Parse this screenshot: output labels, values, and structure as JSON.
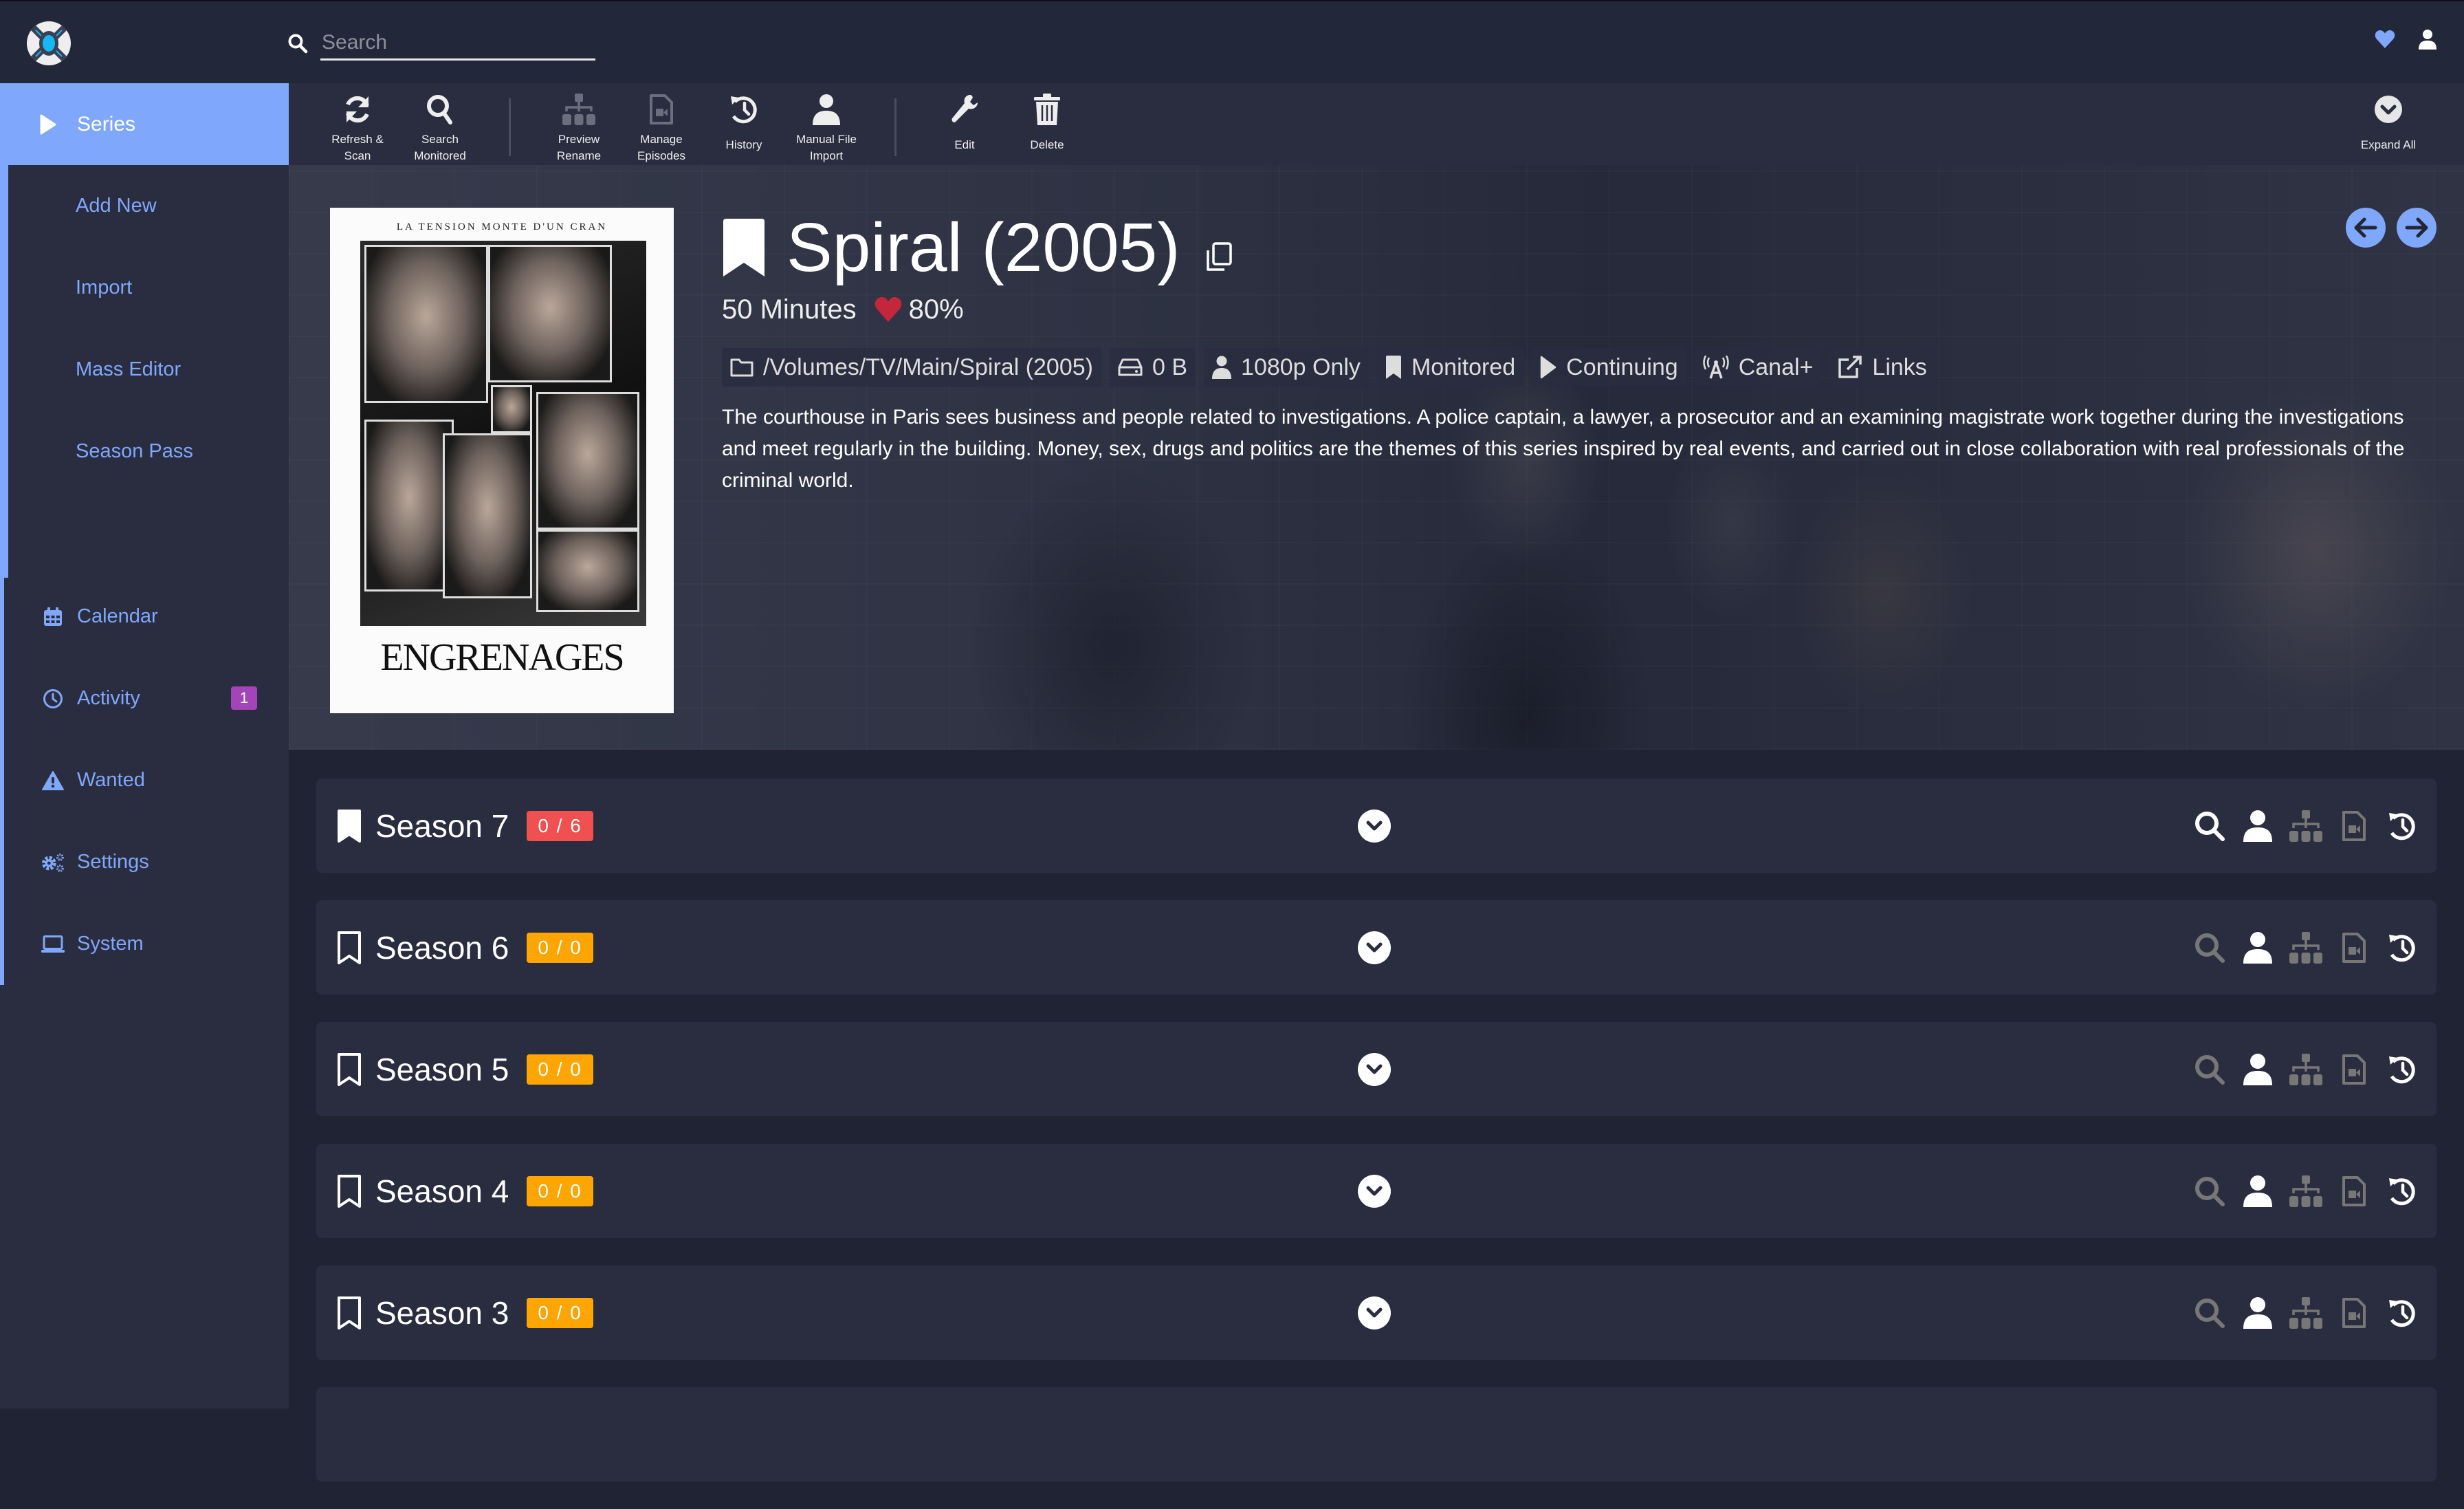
{
  "app": {
    "search": {
      "placeholder": "Search",
      "value": ""
    },
    "header_icons": [
      "heart-icon",
      "user-icon"
    ],
    "colors": {
      "accent": "#7fa7fb",
      "danger": "#f05050",
      "warning": "#ffa500",
      "badge_purple": "#a345b8",
      "rating_heart": "#c4273c"
    }
  },
  "sidebar": {
    "active": {
      "label": "Series",
      "icon": "play-icon"
    },
    "sub_items": [
      {
        "label": "Add New"
      },
      {
        "label": "Import"
      },
      {
        "label": "Mass Editor"
      },
      {
        "label": "Season Pass"
      }
    ],
    "items": [
      {
        "label": "Calendar",
        "icon": "calendar-icon"
      },
      {
        "label": "Activity",
        "icon": "clock-icon",
        "badge": "1"
      },
      {
        "label": "Wanted",
        "icon": "warning-icon"
      },
      {
        "label": "Settings",
        "icon": "cogs-icon"
      },
      {
        "label": "System",
        "icon": "laptop-icon"
      }
    ]
  },
  "toolbar": {
    "buttons": [
      {
        "label": "Refresh &\nScan",
        "icon": "refresh-icon",
        "enabled": true
      },
      {
        "label": "Search\nMonitored",
        "icon": "search-icon",
        "enabled": true
      },
      {
        "label": "Preview\nRename",
        "icon": "sitemap-icon",
        "enabled": false
      },
      {
        "label": "Manage\nEpisodes",
        "icon": "file-video-icon",
        "enabled": false
      },
      {
        "label": "History",
        "icon": "history-icon",
        "enabled": true
      },
      {
        "label": "Manual File\nImport",
        "icon": "user-icon",
        "enabled": true
      },
      {
        "label": "Edit",
        "icon": "wrench-icon",
        "enabled": true
      },
      {
        "label": "Delete",
        "icon": "trash-icon",
        "enabled": true
      }
    ],
    "expand_all": {
      "label": "Expand All",
      "icon": "chevron-circle-down-icon"
    }
  },
  "series": {
    "title": "Spiral (2005)",
    "monitored": true,
    "runtime": "50 Minutes",
    "rating": "80%",
    "poster": {
      "tagline": "LA TENSION MONTE D'UN CRAN",
      "title": "ENGRENAGES"
    },
    "tags": [
      {
        "icon": "folder-icon",
        "label": "/Volumes/TV/Main/Spiral (2005)"
      },
      {
        "icon": "drive-icon",
        "label": "0 B"
      },
      {
        "icon": "user-icon",
        "label": "1080p Only"
      },
      {
        "icon": "bookmark-icon",
        "label": "Monitored"
      },
      {
        "icon": "play-icon",
        "label": "Continuing"
      },
      {
        "icon": "broadcast-icon",
        "label": "Canal+"
      },
      {
        "icon": "external-link-icon",
        "label": "Links"
      }
    ],
    "overview": "The courthouse in Paris sees business and people related to investigations. A police captain, a lawyer, a prosecutor and an examining magistrate work together during the investigations and meet regularly in the building. Money, sex, drugs and politics are the themes of this series inspired by real events, and carried out in close collaboration with real professionals of the criminal world."
  },
  "seasons": [
    {
      "name": "Season 7",
      "badge": "0 / 6",
      "badge_color": "#f05050",
      "monitored": true,
      "search_enabled": true
    },
    {
      "name": "Season 6",
      "badge": "0 / 0",
      "badge_color": "#ffa500",
      "monitored": false,
      "search_enabled": false
    },
    {
      "name": "Season 5",
      "badge": "0 / 0",
      "badge_color": "#ffa500",
      "monitored": false,
      "search_enabled": false
    },
    {
      "name": "Season 4",
      "badge": "0 / 0",
      "badge_color": "#ffa500",
      "monitored": false,
      "search_enabled": false
    },
    {
      "name": "Season 3",
      "badge": "0 / 0",
      "badge_color": "#ffa500",
      "monitored": false,
      "search_enabled": false
    }
  ]
}
